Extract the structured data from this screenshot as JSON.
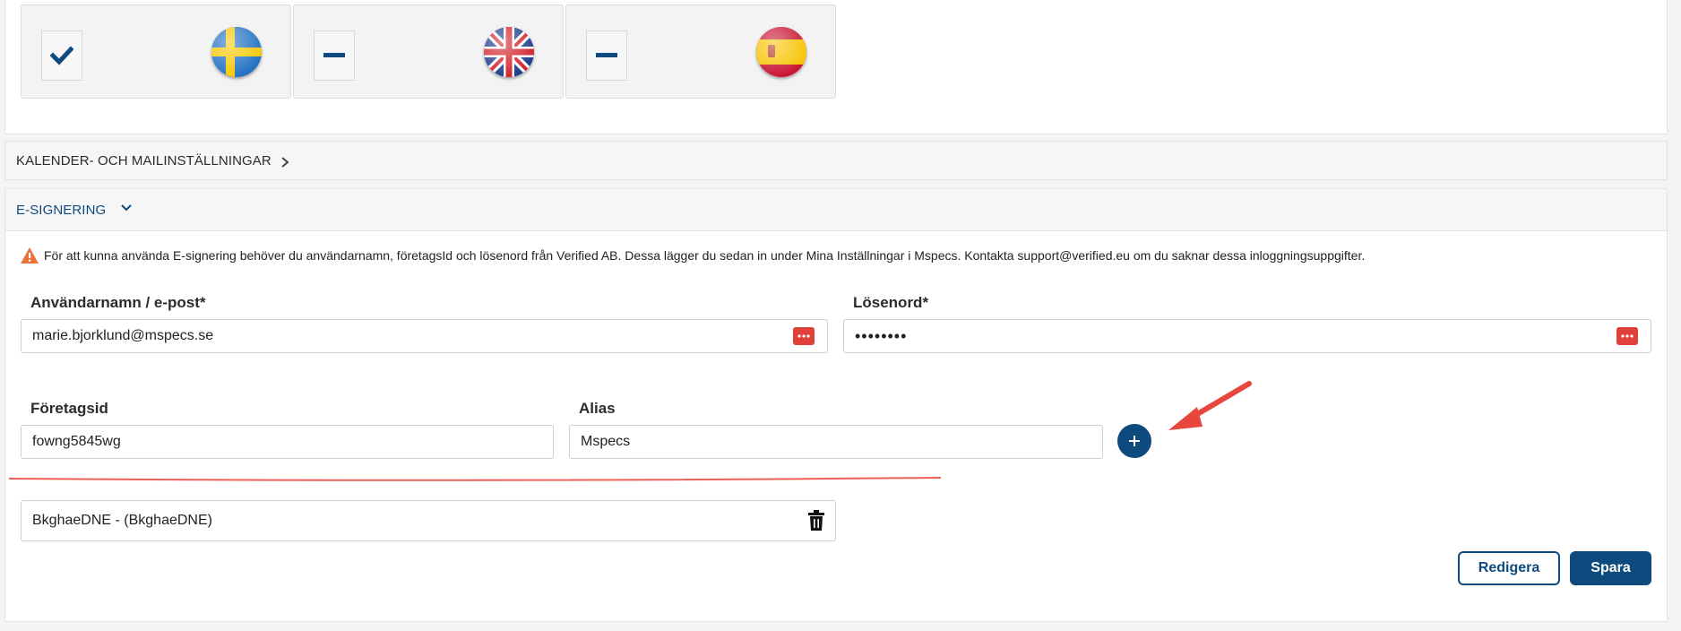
{
  "languages": [
    {
      "name": "swedish",
      "checked": true,
      "flag_icon": "sweden-flag-icon"
    },
    {
      "name": "english",
      "checked": false,
      "flag_icon": "uk-flag-icon"
    },
    {
      "name": "spanish",
      "checked": false,
      "flag_icon": "spain-flag-icon"
    }
  ],
  "sections": {
    "calendar": {
      "title": "KALENDER- OCH MAILINSTÄLLNINGAR",
      "expanded": false
    },
    "esign": {
      "title": "E-SIGNERING",
      "expanded": true
    }
  },
  "esign": {
    "warning": "För att kunna använda E-signering behöver du användarnamn, företagsId och lösenord från Verified AB. Dessa lägger du sedan in under Mina Inställningar i Mspecs. Kontakta support@verified.eu om du saknar dessa inloggningsuppgifter.",
    "username_label": "Användarnamn / e-post*",
    "username_value": "marie.bjorklund@mspecs.se",
    "password_label": "Lösenord*",
    "password_value": "••••••••",
    "company_label": "Företagsid",
    "company_value": "fowng5845wg",
    "alias_label": "Alias",
    "alias_value": "Mspecs",
    "saved_items": [
      {
        "label": "BkghaeDNE - (BkghaeDNE)"
      }
    ],
    "edit_button": "Redigera",
    "save_button": "Spara"
  },
  "colors": {
    "primary": "#0f4a7e",
    "danger_icon": "#e0403a",
    "warning": "#e8743b",
    "annotation": "#e8453c"
  }
}
